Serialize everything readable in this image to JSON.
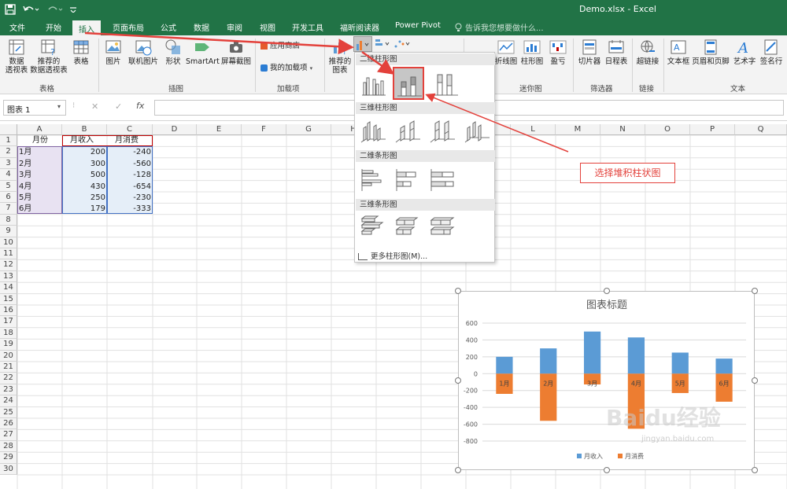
{
  "window": {
    "title": "Demo.xlsx - Excel"
  },
  "qat": {
    "save_icon": "save-icon",
    "undo_icon": "undo-icon",
    "redo_icon": "redo-icon",
    "more_icon": "customize-icon"
  },
  "tabs": [
    {
      "label": "文件"
    },
    {
      "label": "开始"
    },
    {
      "label": "插入"
    },
    {
      "label": "页面布局"
    },
    {
      "label": "公式"
    },
    {
      "label": "数据"
    },
    {
      "label": "审阅"
    },
    {
      "label": "视图"
    },
    {
      "label": "开发工具"
    },
    {
      "label": "福昕阅读器"
    },
    {
      "label": "Power Pivot"
    }
  ],
  "tell_me": "告诉我您想要做什么...",
  "ribbon": {
    "tables": {
      "pivot": "数据\n透视表",
      "rec_pivot": "推荐的\n数据透视表",
      "table": "表格",
      "group": "表格"
    },
    "illustrations": {
      "picture": "图片",
      "online_picture": "联机图片",
      "shapes": "形状",
      "smartart": "SmartArt",
      "screenshot": "屏幕截图",
      "group": "插图"
    },
    "addins": {
      "store": "应用商店",
      "my_addins": "我的加载项",
      "group": "加载项"
    },
    "charts": {
      "recommended": "推荐的\n图表"
    },
    "sparklines": {
      "line": "折线图",
      "column": "柱形图",
      "winloss": "盈亏",
      "group": "迷你图"
    },
    "filters": {
      "slicer": "切片器",
      "timeline": "日程表",
      "group": "筛选器"
    },
    "links": {
      "hyperlink": "超链接",
      "group": "链接"
    },
    "text": {
      "textbox": "文本框",
      "header_footer": "页眉和页脚",
      "wordart": "艺术字",
      "signature": "签名行",
      "group": "文本"
    }
  },
  "formula_bar": {
    "name_box": "图表 1",
    "cancel": "✕",
    "enter": "✓",
    "fx": "fx",
    "value": ""
  },
  "dropdown": {
    "sec_2d_col": "二维柱形图",
    "sec_3d_col": "三维柱形图",
    "sec_2d_bar": "二维条形图",
    "sec_3d_bar": "三维条形图",
    "more": "更多柱形图(M)..."
  },
  "annotation": {
    "callout": "选择堆积柱状图"
  },
  "columns": [
    "A",
    "B",
    "C",
    "D",
    "E",
    "F",
    "G",
    "H",
    "I",
    "J",
    "K",
    "L",
    "M",
    "N",
    "O",
    "P",
    "Q"
  ],
  "rows": [
    "1",
    "2",
    "3",
    "4",
    "5",
    "6",
    "7",
    "8",
    "9",
    "10",
    "11",
    "12",
    "13",
    "14",
    "15",
    "16",
    "17",
    "18",
    "19",
    "20",
    "21",
    "22",
    "23",
    "24",
    "25",
    "26",
    "27",
    "28",
    "29",
    "30"
  ],
  "sheet": {
    "headers": [
      "月份",
      "月收入",
      "月消费"
    ],
    "data": [
      [
        "1月",
        "200",
        "-240"
      ],
      [
        "2月",
        "300",
        "-560"
      ],
      [
        "3月",
        "500",
        "-128"
      ],
      [
        "4月",
        "430",
        "-654"
      ],
      [
        "5月",
        "250",
        "-230"
      ],
      [
        "6月",
        "179",
        "-333"
      ]
    ]
  },
  "colors": {
    "ribbon_green": "#217346",
    "income": "#5b9bd5",
    "expense": "#ed7d31",
    "annotation_red": "#e3413b"
  },
  "chart_data": {
    "type": "bar",
    "stacked": true,
    "title": "图表标题",
    "categories": [
      "1月",
      "2月",
      "3月",
      "4月",
      "5月",
      "6月"
    ],
    "series": [
      {
        "name": "月收入",
        "values": [
          200,
          300,
          500,
          430,
          250,
          179
        ],
        "color": "#5b9bd5"
      },
      {
        "name": "月消费",
        "values": [
          -240,
          -560,
          -128,
          -654,
          -230,
          -333
        ],
        "color": "#ed7d31"
      }
    ],
    "yticks": [
      600,
      400,
      200,
      0,
      -200,
      -400,
      -600,
      -800
    ],
    "ylim": [
      -800,
      600
    ],
    "grid": true,
    "legend": "bottom"
  },
  "watermark": {
    "text": "Baidu经验",
    "url": "jingyan.baidu.com"
  }
}
